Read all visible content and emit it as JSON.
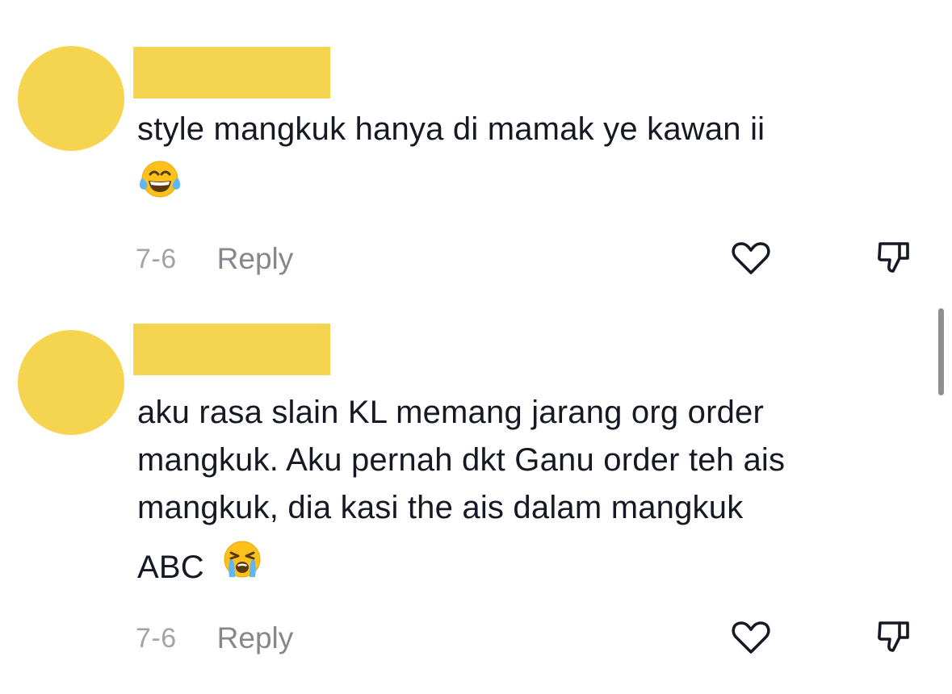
{
  "comments": [
    {
      "lines": [
        "style mangkuk hanya di mamak ye kawan ii"
      ],
      "emoji_line_text": "",
      "emoji": "face-with-tears-of-joy",
      "date": "7-6",
      "reply_label": "Reply"
    },
    {
      "lines": [
        "aku rasa slain KL memang jarang org order",
        "mangkuk. Aku pernah dkt Ganu order teh ais",
        "mangkuk, dia kasi the ais dalam mangkuk"
      ],
      "emoji_line_text": "ABC",
      "emoji": "loudly-crying-face",
      "date": "7-6",
      "reply_label": "Reply"
    }
  ],
  "colors": {
    "avatar_placeholder": "#f5d44f",
    "text": "#161823",
    "date": "#a3a4aa",
    "reply": "#86878c",
    "icon": "#161823"
  }
}
